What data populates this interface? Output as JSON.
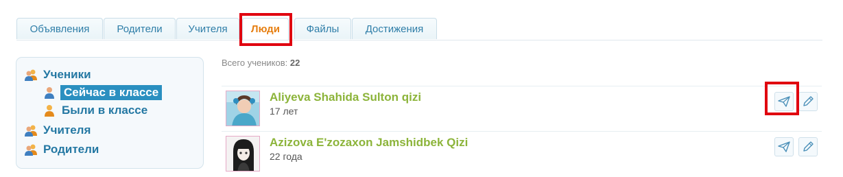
{
  "tabs": [
    {
      "label": "Объявления",
      "active": false
    },
    {
      "label": "Родители",
      "active": false
    },
    {
      "label": "Учителя",
      "active": false
    },
    {
      "label": "Люди",
      "active": true
    },
    {
      "label": "Файлы",
      "active": false
    },
    {
      "label": "Достижения",
      "active": false
    }
  ],
  "sidebar": {
    "items": [
      {
        "label": "Ученики",
        "icon": "people-icon"
      },
      {
        "label": "Сейчас в классе",
        "icon": "person-icon",
        "selected": true
      },
      {
        "label": "Были в классе",
        "icon": "person-icon"
      },
      {
        "label": "Учителя",
        "icon": "people-icon"
      },
      {
        "label": "Родители",
        "icon": "people-icon"
      }
    ]
  },
  "main": {
    "total_label": "Всего учеников:",
    "total_value": "22",
    "students": [
      {
        "name": "Aliyeva Shahida Sulton qizi",
        "age": "17 лет"
      },
      {
        "name": "Azizova E'zozaxon Jamshidbek Qizi",
        "age": "22 года"
      }
    ]
  },
  "colors": {
    "accent_blue": "#2478a3",
    "active_tab": "#e67e10",
    "name_green": "#8cb43a",
    "highlight_red": "#e0000f"
  }
}
